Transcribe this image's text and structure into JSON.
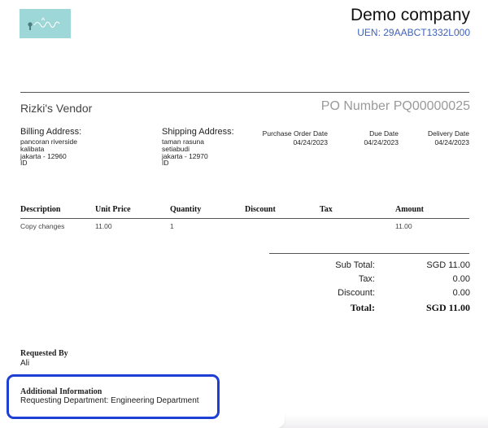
{
  "header": {
    "company": "Demo company",
    "uen": "UEN: 29AABCT1332L000",
    "logo_color": "#9dd7d8"
  },
  "vendor": "Rizki's Vendor",
  "po_number": "PO Number PQ00000025",
  "billing": {
    "heading": "Billing Address:",
    "lines": [
      "pancoran riverside",
      "kalibata",
      "jakarta - 12960",
      "ID"
    ]
  },
  "shipping": {
    "heading": "Shipping Address:",
    "lines": [
      "taman rasuna",
      "setiabudi",
      "jakarta - 12970",
      "ID"
    ]
  },
  "dates": [
    {
      "label": "Purchase Order Date",
      "value": "04/24/2023"
    },
    {
      "label": "Due Date",
      "value": "04/24/2023"
    },
    {
      "label": "Delivery Date",
      "value": "04/24/2023"
    }
  ],
  "table": {
    "headers": [
      "Description",
      "Unit Price",
      "Quantity",
      "Discount",
      "Tax",
      "Amount"
    ],
    "rows": [
      [
        "Copy changes",
        "11.00",
        "1",
        "",
        "",
        "11.00"
      ]
    ]
  },
  "totals": {
    "subtotal_label": "Sub Total:",
    "subtotal_value": "SGD  11.00",
    "tax_label": "Tax:",
    "tax_value": "0.00",
    "discount_label": "Discount:",
    "discount_value": "0.00",
    "total_label": "Total:",
    "total_value": "SGD  11.00"
  },
  "requested_by": {
    "heading": "Requested By",
    "name": "Ali"
  },
  "additional": {
    "heading": "Additional Information",
    "text": "Requesting Department: Engineering Department",
    "highlight_color": "#1d3fd4"
  }
}
